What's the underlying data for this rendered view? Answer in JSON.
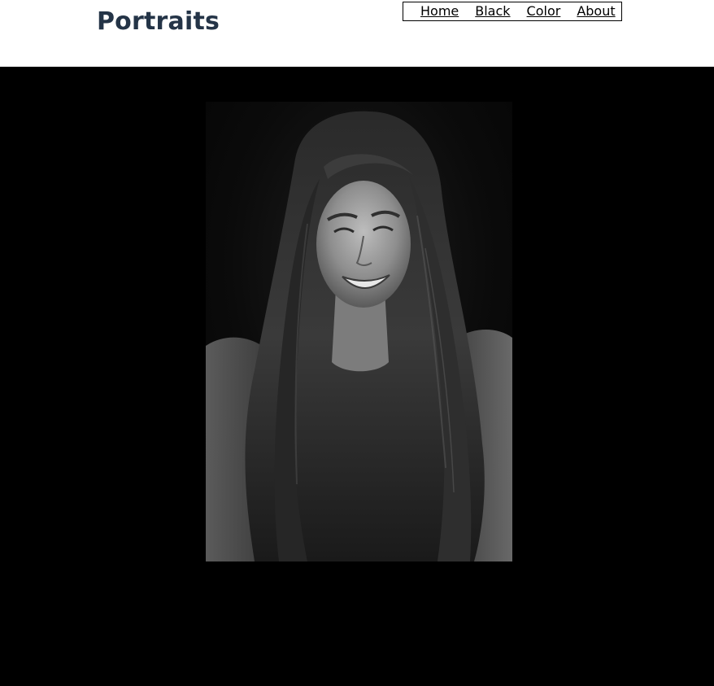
{
  "header": {
    "title": "Portraits"
  },
  "nav": {
    "items": [
      {
        "label": "Home"
      },
      {
        "label": "Black"
      },
      {
        "label": "Color"
      },
      {
        "label": "About"
      }
    ]
  },
  "colors": {
    "title": "#243447",
    "stage_background": "#000000",
    "page_background": "#ffffff"
  },
  "gallery": {
    "image_description": "black-and-white portrait of a smiling woman with long hair"
  }
}
